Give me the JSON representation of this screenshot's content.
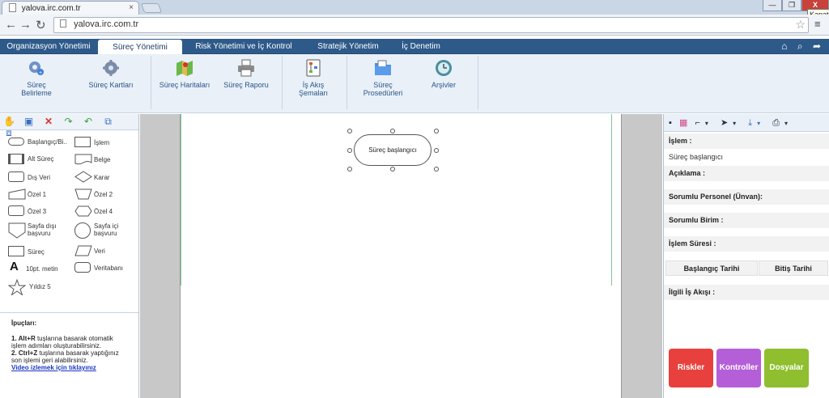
{
  "browser": {
    "tab_title": "yalova.irc.com.tr",
    "url": "yalova.irc.com.tr",
    "tooltip": "Kapat",
    "tab_close": "×",
    "win_min": "—",
    "win_max": "❐",
    "win_close": "X"
  },
  "nav": {
    "tabs": [
      "Organizasyon Yönetimi",
      "Süreç Yönetimi",
      "Risk Yönetimi ve İç Kontrol",
      "Stratejik Yönetim",
      "İç Denetim"
    ],
    "active_index": 1
  },
  "ribbon": {
    "buttons": [
      "Süreç Belirleme",
      "Süreç Kartları",
      "Süreç Haritaları",
      "Süreç Raporu",
      "İş Akış Şemaları",
      "Süreç Prosedürleri",
      "Arşivler"
    ]
  },
  "shapes": {
    "left": [
      "Başlangıç/Bi..",
      "Alt Süreç",
      "Dış Veri",
      "Özel 1",
      "Özel 3",
      "Sayfa dışı başvuru",
      "Süreç",
      "10pt. metin",
      "Yıldız 5"
    ],
    "right": [
      "İşlem",
      "Belge",
      "Karar",
      "Özel 2",
      "Özel 4",
      "Sayfa içi başvuru",
      "Veri",
      "Veritabanı"
    ]
  },
  "tips": {
    "title": "İpuçları:",
    "tip1_num": "1. ",
    "tip1_key": "Alt+R",
    "tip1_text": " tuşlarına basarak otomatik işlem adımları oluşturabilirsiniz.",
    "tip2_num": "2. ",
    "tip2_key": "Ctrl+Z",
    "tip2_text": " tuşlarına basarak yaptığınız son işlemi geri alabilirsiniz.",
    "video_link": "Video izlemek için tıklayınız"
  },
  "canvas": {
    "node_label": "Süreç başlangıcı"
  },
  "properties": {
    "islem_label": "İşlem :",
    "islem_value": "Süreç başlangıcı",
    "aciklama_label": "Açıklama :",
    "sorumlu_personel_label": "Sorumlu Personel (Ünvan):",
    "sorumlu_birim_label": "Sorumlu Birim :",
    "islem_suresi_label": "İşlem Süresi :",
    "baslangic_tarihi": "Başlangıç Tarihi",
    "bitis_tarihi": "Bitiş Tarihi",
    "ilgili_is_akisi_label": "İlgili İş Akışı :"
  },
  "actions": {
    "riskler": "Riskler",
    "kontroller": "Kontroller",
    "dosyalar": "Dosyalar"
  },
  "colors": {
    "nav_bg": "#2e5a8a",
    "riskler": "#e8403c",
    "kontroller": "#b45fd8",
    "dosyalar": "#8fbe2e",
    "ribbon_text": "#2a5688"
  },
  "icons": {
    "hand": "✋",
    "crop": "▣",
    "delete": "✕",
    "redo": "↷",
    "undo": "↶",
    "group": "⧉",
    "ungroup": "⧈",
    "save": "💾",
    "color": "▦",
    "connector": "⌐",
    "arrow": "➤",
    "download": "⤓",
    "print": "⎙",
    "home": "⌂",
    "search": "⌕",
    "share": "➦",
    "back": "←",
    "forward": "→",
    "reload": "↻",
    "star": "☆",
    "menu": "≡",
    "caret": "▾"
  }
}
